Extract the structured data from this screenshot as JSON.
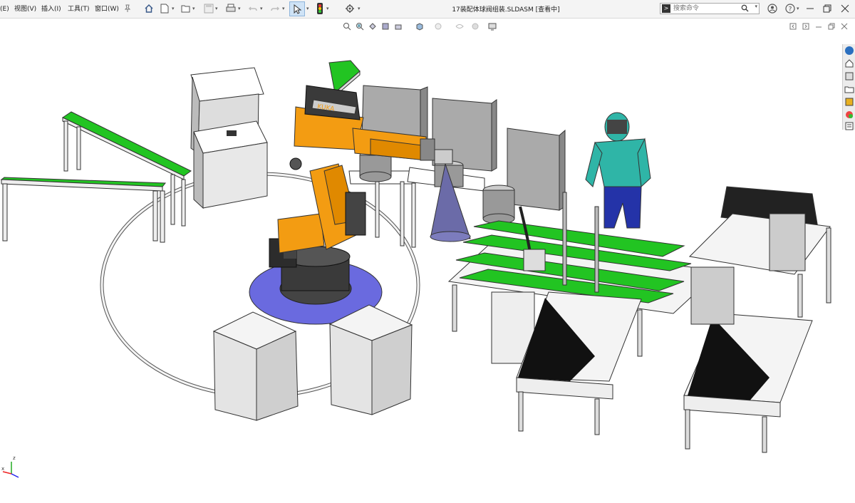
{
  "menu": {
    "partial_edit": "(E)",
    "view": "视图(V)",
    "insert": "插入(I)",
    "tools": "工具(T)",
    "window": "窗口(W)"
  },
  "title": "17装配体球阀组装.SLDASM [查看中]",
  "search": {
    "placeholder": "搜索命令"
  },
  "axis": {
    "z": "z",
    "x": "x"
  },
  "colors": {
    "robot_orange": "#f39c12",
    "conveyor_green": "#22c422",
    "base_blue": "#6a6adf",
    "worker_shirt": "#2fb5a7",
    "worker_pants": "#2433a8",
    "machine_gray": "#9a9a9a"
  },
  "icons": [
    "home-icon",
    "new-document-icon",
    "open-icon",
    "save-icon",
    "print-icon",
    "undo-icon",
    "redo-icon",
    "select-cursor-icon",
    "traffic-light-icon",
    "settings-gear-icon",
    "help-icon",
    "user-icon",
    "notifications-icon",
    "minimize-icon",
    "restore-icon",
    "close-icon"
  ],
  "robot_brand": "KUKA"
}
